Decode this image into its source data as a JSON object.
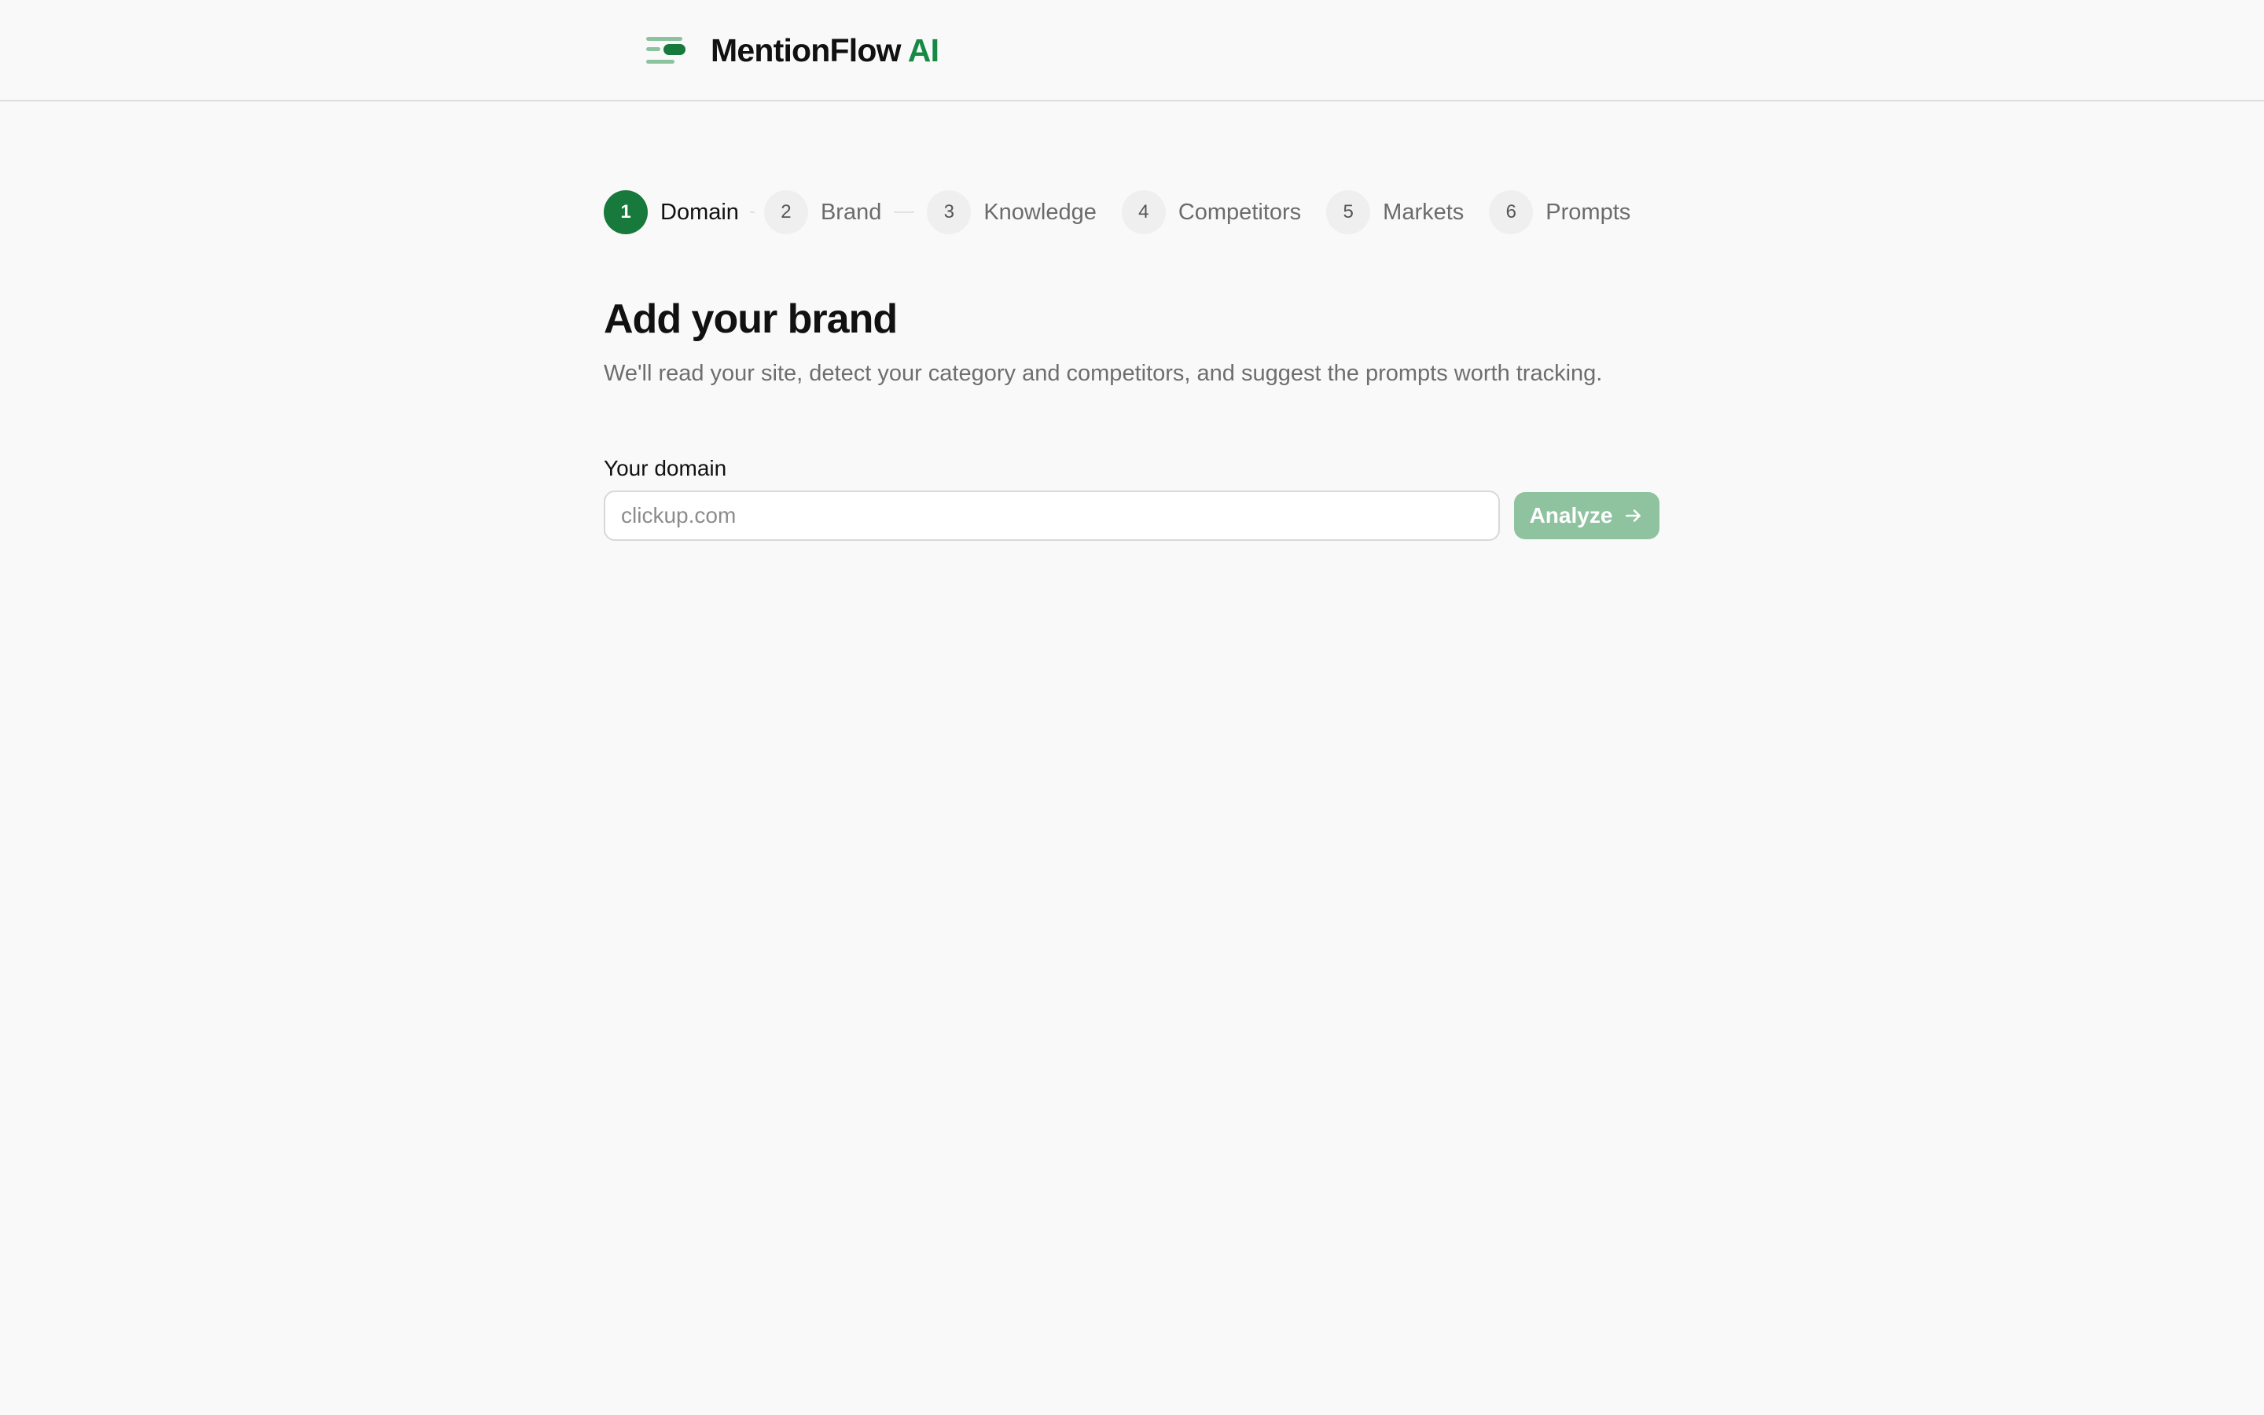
{
  "header": {
    "brand_name": "MentionFlow",
    "brand_accent": "AI",
    "logo_icon": "stacked-lines-logo-icon"
  },
  "stepper": {
    "steps": [
      {
        "number": "1",
        "label": "Domain",
        "active": true
      },
      {
        "number": "2",
        "label": "Brand",
        "active": false
      },
      {
        "number": "3",
        "label": "Knowledge",
        "active": false
      },
      {
        "number": "4",
        "label": "Competitors",
        "active": false
      },
      {
        "number": "5",
        "label": "Markets",
        "active": false
      },
      {
        "number": "6",
        "label": "Prompts",
        "active": false
      }
    ]
  },
  "main": {
    "title": "Add your brand",
    "subtitle": "We'll read your site, detect your category and competitors, and suggest the prompts worth tracking.",
    "field_label": "Your domain",
    "domain_placeholder": "clickup.com",
    "analyze_label": "Analyze",
    "analyze_icon": "arrow-right-icon"
  },
  "colors": {
    "accent": "#17793b",
    "accent_text": "#168a45",
    "button_disabled": "#8fc39f",
    "background": "#f9f9f9"
  }
}
